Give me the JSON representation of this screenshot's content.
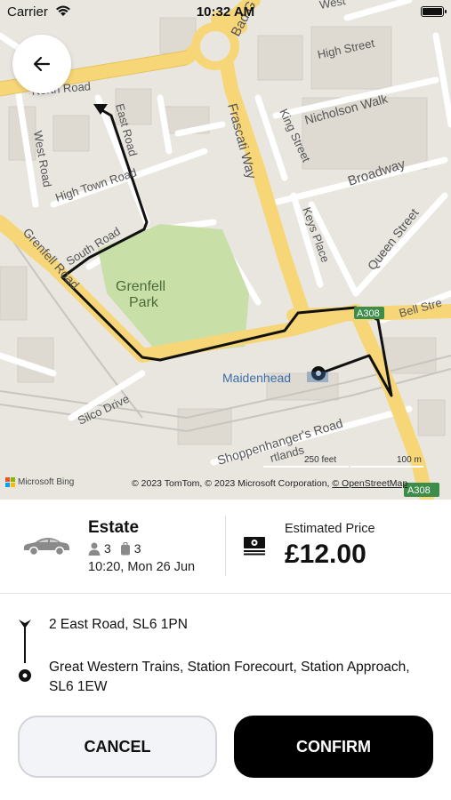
{
  "status_bar": {
    "carrier": "Carrier",
    "time": "10:32 AM"
  },
  "map": {
    "labels": {
      "north_road": "North Road",
      "east_road": "East Road",
      "west_road": "West Road",
      "high_town_road": "High Town Road",
      "south_road": "South Road",
      "grenfell_road": "Grenfell Road",
      "grenfell_park_1": "Grenfell",
      "grenfell_park_2": "Park",
      "frascati_way": "Frascati Way",
      "bad_g": "Bad G",
      "west": "West",
      "high_street": "High Street",
      "nicholson_walk": "Nicholson Walk",
      "king_street": "King Street",
      "broadway": "Broadway",
      "keys_place": "Keys Place",
      "queen_street": "Queen Street",
      "bell_street": "Bell Stre",
      "a308": "A308",
      "a308_bottom": "A308",
      "maidenhead": "Maidenhead",
      "silco_drive": "Silco Drive",
      "shoppenhangers_road": "Shoppenhanger's Road",
      "portlands": "rtlands"
    },
    "scale_feet": "250 feet",
    "scale_m": "100 m",
    "brand": "Microsoft Bing",
    "copyright_prefix": "© 2023 TomTom, © 2023 Microsoft Corporation, ",
    "copyright_link": "© OpenStreetMap",
    "colors": {
      "road_major": "#f7d678",
      "road_minor": "#ffffff",
      "park": "#c9dfa8",
      "route": "#111111"
    }
  },
  "vehicle": {
    "name": "Estate",
    "passengers": "3",
    "luggage": "3",
    "pickup_time": "10:20, Mon 26 Jun",
    "icon": "car-icon"
  },
  "price": {
    "label": "Estimated Price",
    "value": "£12.00",
    "icon": "cash-icon"
  },
  "route": {
    "pickup": "2 East Road, SL6 1PN",
    "dropoff": "Great Western Trains, Station Forecourt, Station Approach, SL6 1EW"
  },
  "actions": {
    "cancel": "CANCEL",
    "confirm": "CONFIRM"
  }
}
